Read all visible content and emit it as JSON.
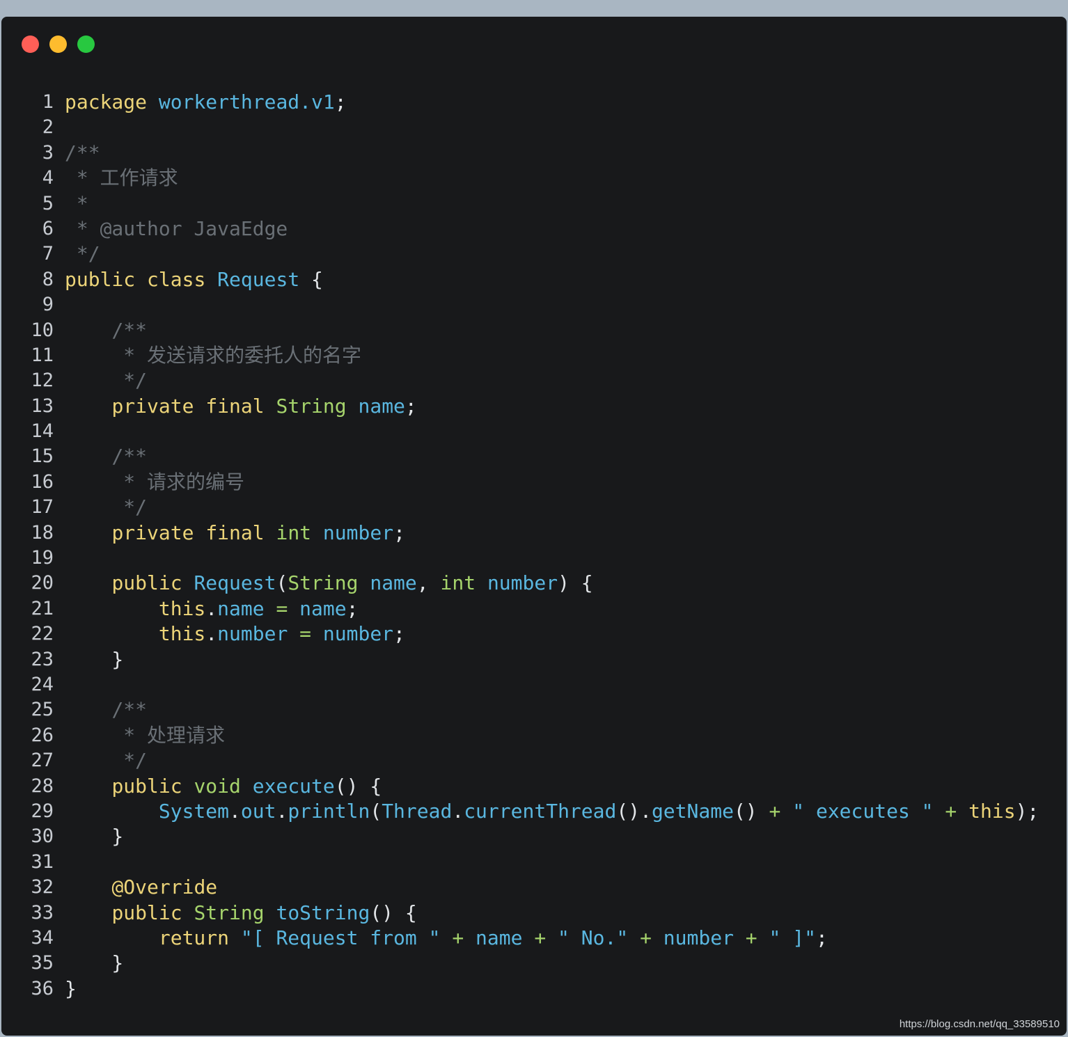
{
  "window": {
    "traffic_lights": [
      {
        "name": "close",
        "color": "#ff5f57"
      },
      {
        "name": "minimize",
        "color": "#febc2e"
      },
      {
        "name": "maximize",
        "color": "#28c840"
      }
    ]
  },
  "colors": {
    "background": "#18191b",
    "keyword": "#ecd479",
    "identifier": "#5ab7e0",
    "type": "#a6d46c",
    "comment": "#6a7076"
  },
  "code": {
    "lines": [
      {
        "n": "1",
        "tokens": [
          [
            "kw",
            "package"
          ],
          [
            "pn",
            " "
          ],
          [
            "id",
            "workerthread.v1"
          ],
          [
            "pn",
            ";"
          ]
        ]
      },
      {
        "n": "2",
        "tokens": []
      },
      {
        "n": "3",
        "tokens": [
          [
            "cm",
            "/**"
          ]
        ]
      },
      {
        "n": "4",
        "tokens": [
          [
            "cm",
            " * 工作请求"
          ]
        ]
      },
      {
        "n": "5",
        "tokens": [
          [
            "cm",
            " *"
          ]
        ]
      },
      {
        "n": "6",
        "tokens": [
          [
            "cm",
            " * @author JavaEdge"
          ]
        ]
      },
      {
        "n": "7",
        "tokens": [
          [
            "cm",
            " */"
          ]
        ]
      },
      {
        "n": "8",
        "tokens": [
          [
            "kw",
            "public"
          ],
          [
            "pn",
            " "
          ],
          [
            "kw",
            "class"
          ],
          [
            "pn",
            " "
          ],
          [
            "id",
            "Request"
          ],
          [
            "pn",
            " {"
          ]
        ]
      },
      {
        "n": "9",
        "tokens": []
      },
      {
        "n": "10",
        "tokens": [
          [
            "pn",
            "    "
          ],
          [
            "cm",
            "/**"
          ]
        ]
      },
      {
        "n": "11",
        "tokens": [
          [
            "pn",
            "    "
          ],
          [
            "cm",
            " * 发送请求的委托人的名字"
          ]
        ]
      },
      {
        "n": "12",
        "tokens": [
          [
            "pn",
            "    "
          ],
          [
            "cm",
            " */"
          ]
        ]
      },
      {
        "n": "13",
        "tokens": [
          [
            "pn",
            "    "
          ],
          [
            "kw",
            "private"
          ],
          [
            "pn",
            " "
          ],
          [
            "kw",
            "final"
          ],
          [
            "pn",
            " "
          ],
          [
            "ty",
            "String"
          ],
          [
            "pn",
            " "
          ],
          [
            "id",
            "name"
          ],
          [
            "pn",
            ";"
          ]
        ]
      },
      {
        "n": "14",
        "tokens": []
      },
      {
        "n": "15",
        "tokens": [
          [
            "pn",
            "    "
          ],
          [
            "cm",
            "/**"
          ]
        ]
      },
      {
        "n": "16",
        "tokens": [
          [
            "pn",
            "    "
          ],
          [
            "cm",
            " * 请求的编号"
          ]
        ]
      },
      {
        "n": "17",
        "tokens": [
          [
            "pn",
            "    "
          ],
          [
            "cm",
            " */"
          ]
        ]
      },
      {
        "n": "18",
        "tokens": [
          [
            "pn",
            "    "
          ],
          [
            "kw",
            "private"
          ],
          [
            "pn",
            " "
          ],
          [
            "kw",
            "final"
          ],
          [
            "pn",
            " "
          ],
          [
            "ty",
            "int"
          ],
          [
            "pn",
            " "
          ],
          [
            "id",
            "number"
          ],
          [
            "pn",
            ";"
          ]
        ]
      },
      {
        "n": "19",
        "tokens": []
      },
      {
        "n": "20",
        "tokens": [
          [
            "pn",
            "    "
          ],
          [
            "kw",
            "public"
          ],
          [
            "pn",
            " "
          ],
          [
            "id",
            "Request"
          ],
          [
            "pn",
            "("
          ],
          [
            "ty",
            "String"
          ],
          [
            "pn",
            " "
          ],
          [
            "id",
            "name"
          ],
          [
            "pn",
            ", "
          ],
          [
            "ty",
            "int"
          ],
          [
            "pn",
            " "
          ],
          [
            "id",
            "number"
          ],
          [
            "pn",
            ") {"
          ]
        ]
      },
      {
        "n": "21",
        "tokens": [
          [
            "pn",
            "        "
          ],
          [
            "kw",
            "this"
          ],
          [
            "pn",
            "."
          ],
          [
            "id",
            "name"
          ],
          [
            "pn",
            " "
          ],
          [
            "op",
            "="
          ],
          [
            "pn",
            " "
          ],
          [
            "id",
            "name"
          ],
          [
            "pn",
            ";"
          ]
        ]
      },
      {
        "n": "22",
        "tokens": [
          [
            "pn",
            "        "
          ],
          [
            "kw",
            "this"
          ],
          [
            "pn",
            "."
          ],
          [
            "id",
            "number"
          ],
          [
            "pn",
            " "
          ],
          [
            "op",
            "="
          ],
          [
            "pn",
            " "
          ],
          [
            "id",
            "number"
          ],
          [
            "pn",
            ";"
          ]
        ]
      },
      {
        "n": "23",
        "tokens": [
          [
            "pn",
            "    }"
          ]
        ]
      },
      {
        "n": "24",
        "tokens": []
      },
      {
        "n": "25",
        "tokens": [
          [
            "pn",
            "    "
          ],
          [
            "cm",
            "/**"
          ]
        ]
      },
      {
        "n": "26",
        "tokens": [
          [
            "pn",
            "    "
          ],
          [
            "cm",
            " * 处理请求"
          ]
        ]
      },
      {
        "n": "27",
        "tokens": [
          [
            "pn",
            "    "
          ],
          [
            "cm",
            " */"
          ]
        ]
      },
      {
        "n": "28",
        "tokens": [
          [
            "pn",
            "    "
          ],
          [
            "kw",
            "public"
          ],
          [
            "pn",
            " "
          ],
          [
            "ty",
            "void"
          ],
          [
            "pn",
            " "
          ],
          [
            "id",
            "execute"
          ],
          [
            "pn",
            "() {"
          ]
        ]
      },
      {
        "n": "29",
        "tokens": [
          [
            "pn",
            "        "
          ],
          [
            "id",
            "System"
          ],
          [
            "pn",
            "."
          ],
          [
            "id",
            "out"
          ],
          [
            "pn",
            "."
          ],
          [
            "id",
            "println"
          ],
          [
            "pn",
            "("
          ],
          [
            "id",
            "Thread"
          ],
          [
            "pn",
            "."
          ],
          [
            "id",
            "currentThread"
          ],
          [
            "pn",
            "()."
          ],
          [
            "id",
            "getName"
          ],
          [
            "pn",
            "() "
          ],
          [
            "op",
            "+"
          ],
          [
            "pn",
            " "
          ],
          [
            "str",
            "\" executes \""
          ],
          [
            "pn",
            " "
          ],
          [
            "op",
            "+"
          ],
          [
            "pn",
            " "
          ],
          [
            "kw",
            "this"
          ],
          [
            "pn",
            ");"
          ]
        ]
      },
      {
        "n": "30",
        "tokens": [
          [
            "pn",
            "    }"
          ]
        ]
      },
      {
        "n": "31",
        "tokens": []
      },
      {
        "n": "32",
        "tokens": [
          [
            "pn",
            "    "
          ],
          [
            "an",
            "@Override"
          ]
        ]
      },
      {
        "n": "33",
        "tokens": [
          [
            "pn",
            "    "
          ],
          [
            "kw",
            "public"
          ],
          [
            "pn",
            " "
          ],
          [
            "ty",
            "String"
          ],
          [
            "pn",
            " "
          ],
          [
            "id",
            "toString"
          ],
          [
            "pn",
            "() {"
          ]
        ]
      },
      {
        "n": "34",
        "tokens": [
          [
            "pn",
            "        "
          ],
          [
            "kw",
            "return"
          ],
          [
            "pn",
            " "
          ],
          [
            "str",
            "\"[ Request from \""
          ],
          [
            "pn",
            " "
          ],
          [
            "op",
            "+"
          ],
          [
            "pn",
            " "
          ],
          [
            "id",
            "name"
          ],
          [
            "pn",
            " "
          ],
          [
            "op",
            "+"
          ],
          [
            "pn",
            " "
          ],
          [
            "str",
            "\" No.\""
          ],
          [
            "pn",
            " "
          ],
          [
            "op",
            "+"
          ],
          [
            "pn",
            " "
          ],
          [
            "id",
            "number"
          ],
          [
            "pn",
            " "
          ],
          [
            "op",
            "+"
          ],
          [
            "pn",
            " "
          ],
          [
            "str",
            "\" ]\""
          ],
          [
            "pn",
            ";"
          ]
        ]
      },
      {
        "n": "35",
        "tokens": [
          [
            "pn",
            "    }"
          ]
        ]
      },
      {
        "n": "36",
        "tokens": [
          [
            "pn",
            "}"
          ]
        ]
      }
    ]
  },
  "watermark": "https://blog.csdn.net/qq_33589510"
}
